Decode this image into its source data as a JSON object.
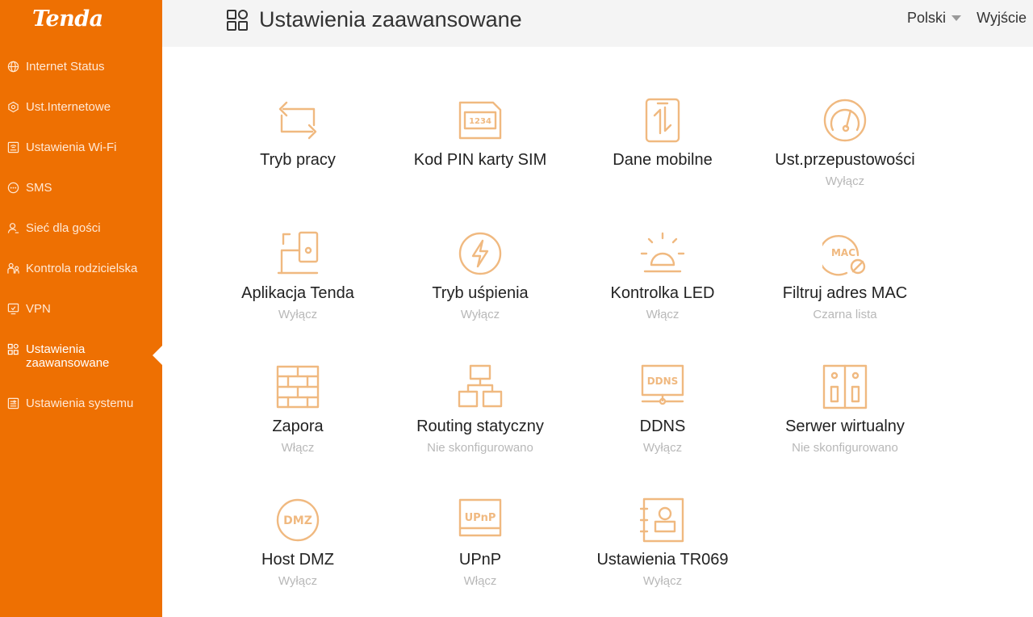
{
  "brand": {
    "logo_text": "Tenda",
    "accent": "#ee7002",
    "icon_color": "#f0b980"
  },
  "header": {
    "title": "Ustawienia zaawansowane",
    "language": "Polski",
    "logout": "Wyjście"
  },
  "sidebar": {
    "items": [
      {
        "label": "Internet Status",
        "icon": "globe-icon"
      },
      {
        "label": "Ust.Internetowe",
        "icon": "network-icon"
      },
      {
        "label": "Ustawienia Wi-Fi",
        "icon": "wifi-settings-icon"
      },
      {
        "label": "SMS",
        "icon": "message-icon"
      },
      {
        "label": "Sieć dla gości",
        "icon": "guest-icon"
      },
      {
        "label": "Kontrola rodzicielska",
        "icon": "parental-icon"
      },
      {
        "label": "VPN",
        "icon": "monitor-icon"
      },
      {
        "label": "Ustawienia zaawansowane",
        "icon": "grid-icon",
        "active": true
      },
      {
        "label": "Ustawienia systemu",
        "icon": "system-icon"
      }
    ]
  },
  "tiles": [
    {
      "label": "Tryb pracy",
      "status": "",
      "icon": "switch-mode-icon",
      "icon_text": ""
    },
    {
      "label": "Kod PIN karty SIM",
      "status": "",
      "icon": "sim-card-icon",
      "icon_text": "1234"
    },
    {
      "label": "Dane mobilne",
      "status": "",
      "icon": "mobile-data-icon",
      "icon_text": ""
    },
    {
      "label": "Ust.przepustowości",
      "status": "Wyłącz",
      "icon": "speedometer-icon",
      "icon_text": ""
    },
    {
      "label": "Aplikacja Tenda",
      "status": "Wyłącz",
      "icon": "app-devices-icon",
      "icon_text": ""
    },
    {
      "label": "Tryb uśpienia",
      "status": "Wyłącz",
      "icon": "lightning-icon",
      "icon_text": ""
    },
    {
      "label": "Kontrolka LED",
      "status": "Włącz",
      "icon": "led-bulb-icon",
      "icon_text": ""
    },
    {
      "label": "Filtruj adres MAC",
      "status": "Czarna lista",
      "icon": "mac-filter-icon",
      "icon_text": "MAC"
    },
    {
      "label": "Zapora",
      "status": "Włącz",
      "icon": "firewall-icon",
      "icon_text": ""
    },
    {
      "label": "Routing statyczny",
      "status": "Nie skonfigurowano",
      "icon": "routing-tree-icon",
      "icon_text": ""
    },
    {
      "label": "DDNS",
      "status": "Wyłącz",
      "icon": "ddns-icon",
      "icon_text": "DDNS"
    },
    {
      "label": "Serwer wirtualny",
      "status": "Nie skonfigurowano",
      "icon": "virtual-server-icon",
      "icon_text": ""
    },
    {
      "label": "Host DMZ",
      "status": "Wyłącz",
      "icon": "dmz-icon",
      "icon_text": "DMZ"
    },
    {
      "label": "UPnP",
      "status": "Włącz",
      "icon": "upnp-icon",
      "icon_text": "UPnP"
    },
    {
      "label": "Ustawienia TR069",
      "status": "Wyłącz",
      "icon": "tr069-icon",
      "icon_text": ""
    }
  ]
}
